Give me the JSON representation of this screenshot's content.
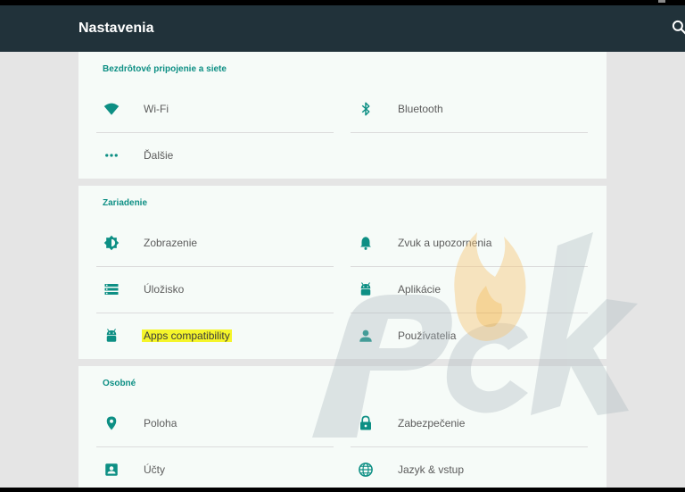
{
  "app": {
    "title": "Nastavenia"
  },
  "sections": [
    {
      "title": "Bezdrôtové pripojenie a siete",
      "items": [
        {
          "label": "Wi-Fi",
          "icon": "wifi-icon"
        },
        {
          "label": "Bluetooth",
          "icon": "bluetooth-icon"
        },
        {
          "label": "Ďalšie",
          "icon": "more-dots-icon"
        }
      ]
    },
    {
      "title": "Zariadenie",
      "items": [
        {
          "label": "Zobrazenie",
          "icon": "brightness-icon"
        },
        {
          "label": "Zvuk a upozornenia",
          "icon": "bell-icon"
        },
        {
          "label": "Úložisko",
          "icon": "storage-icon"
        },
        {
          "label": "Aplikácie",
          "icon": "android-icon"
        },
        {
          "label": "Apps compatibility",
          "icon": "android-icon"
        },
        {
          "label": "Používatelia",
          "icon": "person-icon"
        }
      ]
    },
    {
      "title": "Osobné",
      "items": [
        {
          "label": "Poloha",
          "icon": "location-pin-icon"
        },
        {
          "label": "Zabezpečenie",
          "icon": "lock-icon"
        },
        {
          "label": "Účty",
          "icon": "account-box-icon"
        },
        {
          "label": "Jazyk & vstup",
          "icon": "globe-icon"
        }
      ]
    }
  ],
  "colors": {
    "accent": "#0d8f84",
    "appbar": "#21323a",
    "highlight": "#f5f52a",
    "watermark": "pcsk-logo"
  }
}
